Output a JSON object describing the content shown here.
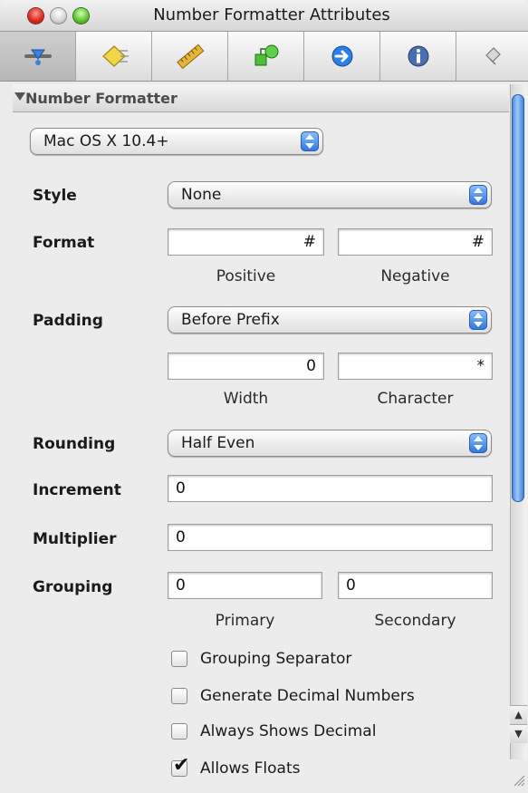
{
  "window": {
    "title": "Number Formatter Attributes",
    "traffic_lights": [
      "close",
      "minimize",
      "zoom"
    ]
  },
  "toolbar": {
    "tabs": [
      {
        "name": "attributes",
        "icon": "attributes-icon",
        "active": true
      },
      {
        "name": "effects",
        "icon": "effects-icon",
        "active": false
      },
      {
        "name": "size",
        "icon": "ruler-icon",
        "active": false
      },
      {
        "name": "bindings",
        "icon": "bindings-icon",
        "active": false
      },
      {
        "name": "connections",
        "icon": "connections-arrow-icon",
        "active": false
      },
      {
        "name": "identity",
        "icon": "info-icon",
        "active": false
      },
      {
        "name": "applescript",
        "icon": "script-icon",
        "active": false
      }
    ]
  },
  "section": {
    "title": "Number Formatter",
    "behavior": "Mac OS X 10.4+"
  },
  "style": {
    "label": "Style",
    "value": "None"
  },
  "format": {
    "label": "Format",
    "positive": "#",
    "negative": "#",
    "positive_label": "Positive",
    "negative_label": "Negative"
  },
  "padding": {
    "label": "Padding",
    "value": "Before Prefix",
    "width": "0",
    "character": "*",
    "width_label": "Width",
    "character_label": "Character"
  },
  "rounding": {
    "label": "Rounding",
    "value": "Half Even"
  },
  "increment": {
    "label": "Increment",
    "value": "0"
  },
  "multiplier": {
    "label": "Multiplier",
    "value": "0"
  },
  "grouping": {
    "label": "Grouping",
    "primary": "0",
    "secondary": "0",
    "primary_label": "Primary",
    "secondary_label": "Secondary"
  },
  "checkboxes": [
    {
      "label": "Grouping Separator",
      "checked": false
    },
    {
      "label": "Generate Decimal Numbers",
      "checked": false
    },
    {
      "label": "Always Shows Decimal",
      "checked": false
    },
    {
      "label": "Allows Floats",
      "checked": true
    }
  ],
  "colors": {
    "accent_blue": "#2f74db",
    "window_bg": "#ececec"
  }
}
